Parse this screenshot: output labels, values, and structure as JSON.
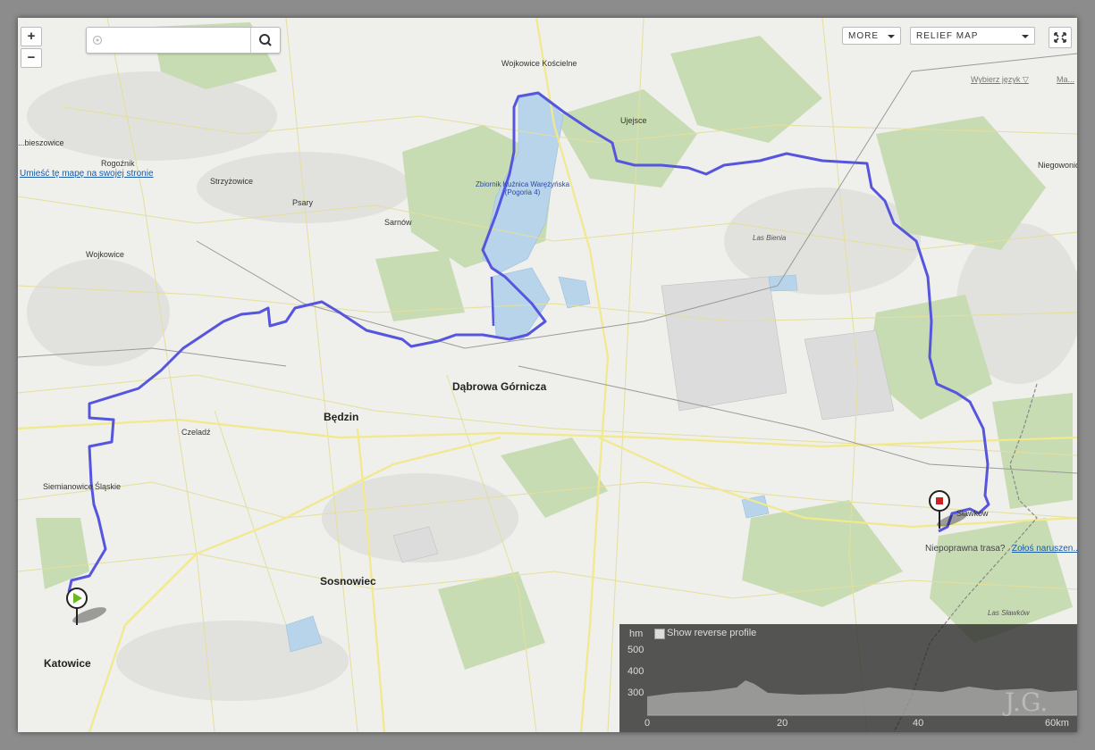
{
  "map": {
    "labels": {
      "wojkowice_koscielne": "Wojkowice Kościelne",
      "ujejsce": "Ujejsce",
      "zbiornik": "Zbiornik Kuźnica Warężyńska",
      "pogoria": "(Pogoria 4)",
      "rogoznik": "Rogoźnik",
      "piekary": "...bieszowice",
      "strzyzowice": "Strzyżowice",
      "psary": "Psary",
      "samow": "Sarnów",
      "wojkowice": "Wojkowice",
      "las_bienia": "Las Bienia",
      "niegowonice": "Niegowonic",
      "dabrowa": "Dąbrowa Górnicza",
      "bedzin": "Będzin",
      "czeladz": "Czeladź",
      "siemianowice": "Siemianowice Śląskie",
      "sosnowiec": "Sosnowiec",
      "katowice": "Katowice",
      "slawkow": "Sławków",
      "las_slawkow": "Las Sławków",
      "las_slawkow2": "Las Sławków"
    },
    "links": {
      "embed": "Umieść tę mapę na swojej stronie",
      "language": "Wybierz język ▽",
      "map_link": "Ma...",
      "report_text": "Niepoprawna trasa?",
      "report_link": "Zołoś naruszen..."
    },
    "colors": {
      "route": "#5555dd",
      "water": "#b8d4ea",
      "forest": "#c8dcb4",
      "road_major": "#f2e88c"
    }
  },
  "controls": {
    "zoom_in": "+",
    "zoom_out": "−",
    "search_placeholder": "",
    "more_label": "MORE",
    "relief_label": "RELIEF MAP"
  },
  "profile": {
    "unit": "hm",
    "reverse_label": "Show reverse profile",
    "y_ticks": [
      "500",
      "400",
      "300"
    ],
    "x_ticks": [
      "0",
      "20",
      "40",
      "60km"
    ],
    "watermark": "J.G."
  }
}
